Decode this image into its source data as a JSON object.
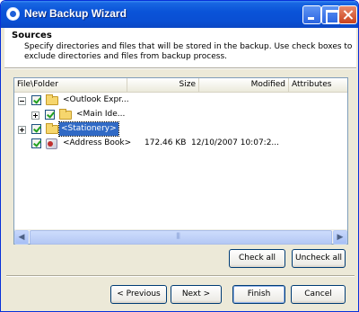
{
  "window": {
    "title": "New Backup Wizard"
  },
  "header": {
    "title": "Sources",
    "description": "Specify directories and files that will be stored in the backup. Use check boxes to exclude directories and files from backup process."
  },
  "columns": [
    "File\\Folder",
    "Size",
    "Modified",
    "Attributes"
  ],
  "rows": [
    {
      "name": "<Outlook Expr...",
      "size": "",
      "modified": "",
      "checked": true,
      "icon": "folder-icon",
      "expander": "minus"
    },
    {
      "name": "<Main Ide...",
      "size": "",
      "modified": "",
      "checked": true,
      "icon": "folder-icon",
      "expander": "plus"
    },
    {
      "name": "<Stationery>",
      "size": "",
      "modified": "",
      "checked": true,
      "icon": "folder-icon",
      "expander": "plus",
      "selected": true
    },
    {
      "name": "<Address Book>",
      "size": "172.46 KB",
      "modified": "12/10/2007 10:07:2...",
      "checked": true,
      "icon": "address-book-icon",
      "expander": ""
    }
  ],
  "buttons": {
    "check_all": "Check all",
    "uncheck_all": "Uncheck all",
    "previous": "< Previous",
    "next": "Next >",
    "finish": "Finish",
    "cancel": "Cancel"
  },
  "colors": {
    "selection": "#316ac5",
    "titlebar": "#0a53d8"
  }
}
